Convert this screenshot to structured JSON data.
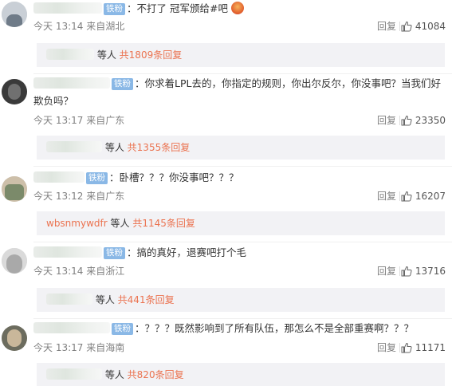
{
  "comments": [
    {
      "badge": "铁粉",
      "prefix": "：",
      "text": "不打了 冠军颁给#",
      "text2": "吧",
      "time": "今天 13:14 来自湖北",
      "reply": "回复",
      "likes": "41084",
      "sub_suffix": "等人",
      "sub_count": "共1809条回复"
    },
    {
      "badge": "铁粉",
      "prefix": "：",
      "text": "你求着LPL去的，你指定的规则，你出尔反尔，你没事吧？当我们好欺负吗？",
      "time": "今天 13:17 来自广东",
      "reply": "回复",
      "likes": "23350",
      "sub_suffix": "等人",
      "sub_count": "共1355条回复"
    },
    {
      "badge": "铁粉",
      "prefix": "：",
      "text": "卧槽？？？你没事吧？？？",
      "time": "今天 13:12 来自广东",
      "reply": "回复",
      "likes": "16207",
      "sub_user": "wbsnmywdfr",
      "sub_suffix": "等人",
      "sub_count": "共1145条回复"
    },
    {
      "badge": "铁粉",
      "prefix": "：",
      "text": "搞的真好，退赛吧打个毛",
      "time": "今天 13:14 来自浙江",
      "reply": "回复",
      "likes": "13716",
      "sub_suffix": "等人",
      "sub_count": "共441条回复"
    },
    {
      "badge": "铁粉",
      "prefix": "：",
      "text": "？？？既然影响到了所有队伍，那怎么不是全部重赛啊？？？",
      "time": "今天 13:17 来自海南",
      "reply": "回复",
      "likes": "11171",
      "sub_suffix": "等人",
      "sub_count": "共820条回复"
    }
  ],
  "icons": {
    "like": "thumbs-up-icon",
    "emoji": "emoji-icon"
  },
  "colors": {
    "accent": "#eb7350",
    "badge": "#8ab8e6",
    "meta": "#808080",
    "sub_bg": "#f2f2f5"
  }
}
